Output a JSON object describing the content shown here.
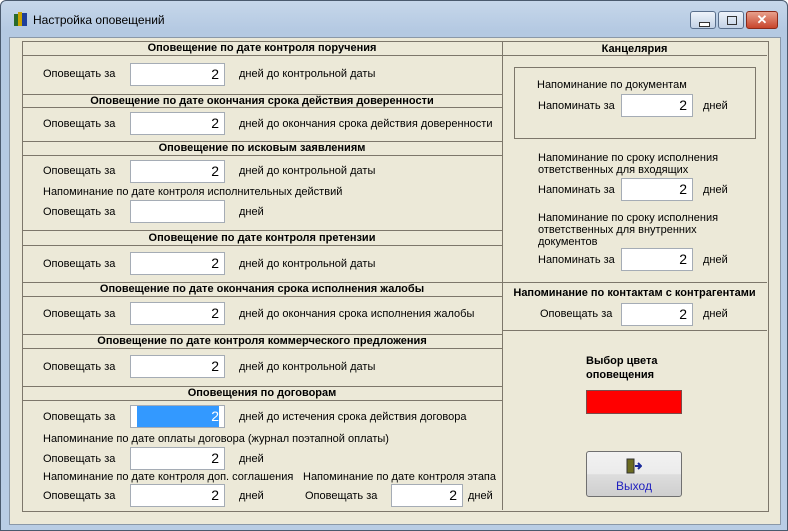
{
  "window": {
    "title": "Настройка оповещений",
    "minimize": "minimize",
    "maximize": "maximize",
    "close": "close"
  },
  "left": {
    "s1": {
      "title": "Оповещение по дате контроля поручения",
      "label": "Оповещать за",
      "value": "2",
      "suffix": "дней до контрольной даты"
    },
    "s2": {
      "title": "Оповещение по дате окончания срока действия доверенности",
      "label": "Оповещать за",
      "value": "2",
      "suffix": "дней до окончания срока действия доверенности"
    },
    "s3": {
      "title": "Оповещение по исковым заявлениям",
      "label": "Оповещать за",
      "value": "2",
      "suffix": "дней до контрольной даты",
      "sub": "Напоминание по дате контроля исполнительных действий",
      "label2": "Оповещать за",
      "value2": "",
      "suffix2": "дней"
    },
    "s4": {
      "title": "Оповещение по дате контроля претензии",
      "label": "Оповещать за",
      "value": "2",
      "suffix": "дней до контрольной даты"
    },
    "s5": {
      "title": "Оповещение по дате окончания срока исполнения жалобы",
      "label": "Оповещать за",
      "value": "2",
      "suffix": "дней до окончания срока исполнения жалобы"
    },
    "s6": {
      "title": "Оповещение по дате контроля коммерческого предложения",
      "label": "Оповещать за",
      "value": "2",
      "suffix": "дней до контрольной даты"
    },
    "s7": {
      "title": "Оповещения по договорам",
      "label": "Оповещать за",
      "value": "2",
      "suffix": "дней до истечения срока действия договора",
      "sub1": "Напоминание по дате оплаты договора (журнал поэтапной оплаты)",
      "label1": "Оповещать за",
      "value1": "2",
      "suffix1": "дней",
      "sub2": "Напоминание по дате контроля доп. соглашения",
      "label2": "Оповещать за",
      "value2": "2",
      "suffix2": "дней",
      "sub3": "Напоминание по дате контроля этапа",
      "label3": "Оповещать за",
      "value3": "2",
      "suffix3": "дней"
    }
  },
  "right": {
    "title": "Канцелярия",
    "docs": {
      "title": "Напоминание по документам",
      "label": "Напоминать за",
      "value": "2",
      "suffix": "дней"
    },
    "incoming": {
      "line1": "Напоминание по сроку исполнения",
      "line2": "ответственных для входящих",
      "label": "Напоминать за",
      "value": "2",
      "suffix": "дней"
    },
    "internal": {
      "line1": "Напоминание по сроку исполнения",
      "line2": "ответственных для внутренних",
      "line3": "документов",
      "label": "Напоминать за",
      "value": "2",
      "suffix": "дней"
    },
    "contacts": {
      "title": "Напоминание по контактам с контрагентами",
      "label": "Оповещать за",
      "value": "2",
      "suffix": "дней"
    },
    "color": {
      "line1": "Выбор цвета",
      "line2": "оповещения",
      "value": "#ff0000"
    },
    "exit": "Выход"
  }
}
